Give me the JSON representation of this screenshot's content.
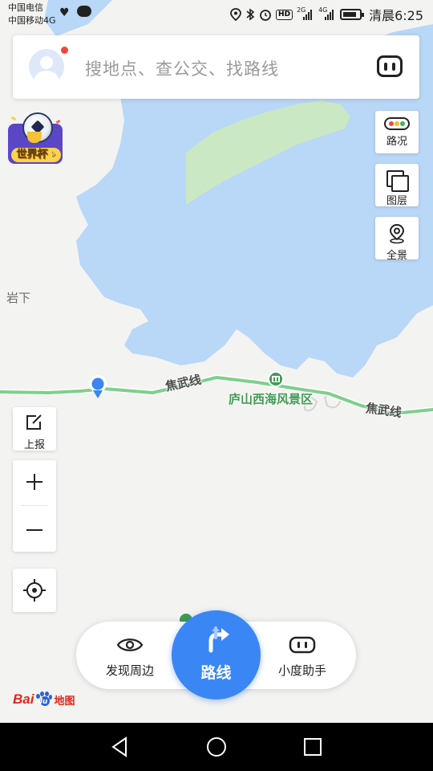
{
  "status_bar": {
    "carrier_1": "中国电信",
    "carrier_2": "中国移动4G",
    "network_2g": "2G",
    "network_4g": "4G",
    "hd": "HD",
    "time": "清晨6:25"
  },
  "search": {
    "placeholder": "搜地点、查公交、找路线",
    "voice_icon": "voice-assistant-icon"
  },
  "promo": {
    "label": "世界杯"
  },
  "tools_right": {
    "traffic": "路况",
    "layers": "图层",
    "panorama": "全景"
  },
  "tools_left": {
    "report": "上报",
    "zoom_in_icon": "plus-icon",
    "zoom_out_icon": "minus-icon",
    "locate_icon": "locate-icon"
  },
  "map": {
    "place_yanxia": "岩下",
    "road_1": "焦武线",
    "road_2": "焦武线",
    "poi": "庐山西海风景区",
    "water_color": "#b9d7f7",
    "land_color": "#f3f3f1",
    "park_color": "#cbe8c5",
    "road_color": "#7dd08a"
  },
  "bottom": {
    "discover": "发现周边",
    "route": "路线",
    "assistant": "小度助手"
  },
  "logo": {
    "bai": "Bai",
    "du": "du",
    "map_text": "地图"
  },
  "colors": {
    "accent": "#3a86f4",
    "badge_red": "#f3453c"
  }
}
